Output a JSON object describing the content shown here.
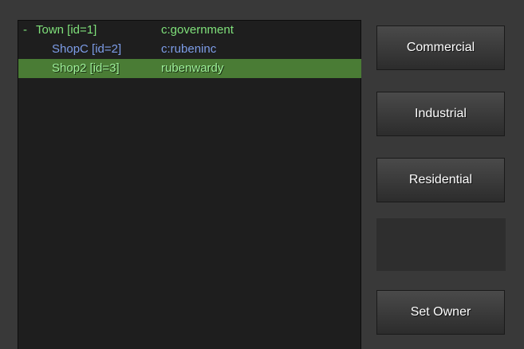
{
  "colors": {
    "green_text": "#7fe07a",
    "blue_text": "#7d9de8",
    "selected_bg": "#4a7c35",
    "list_bg": "#1e1e1e",
    "window_bg": "#393939"
  },
  "tree": {
    "rows": [
      {
        "toggle": "-",
        "name": "Town [id=1]",
        "owner": "c:government",
        "color": "#7fe07a",
        "level": 0,
        "selected": false
      },
      {
        "toggle": "",
        "name": "ShopC [id=2]",
        "owner": "c:rubeninc",
        "color": "#7d9de8",
        "level": 1,
        "selected": false
      },
      {
        "toggle": "",
        "name": "Shop2 [id=3]",
        "owner": "rubenwardy",
        "color": "#9ef09a",
        "level": 1,
        "selected": true
      }
    ]
  },
  "buttons": {
    "commercial": "Commercial",
    "industrial": "Industrial",
    "residential": "Residential",
    "blank": "",
    "set_owner": "Set Owner"
  }
}
